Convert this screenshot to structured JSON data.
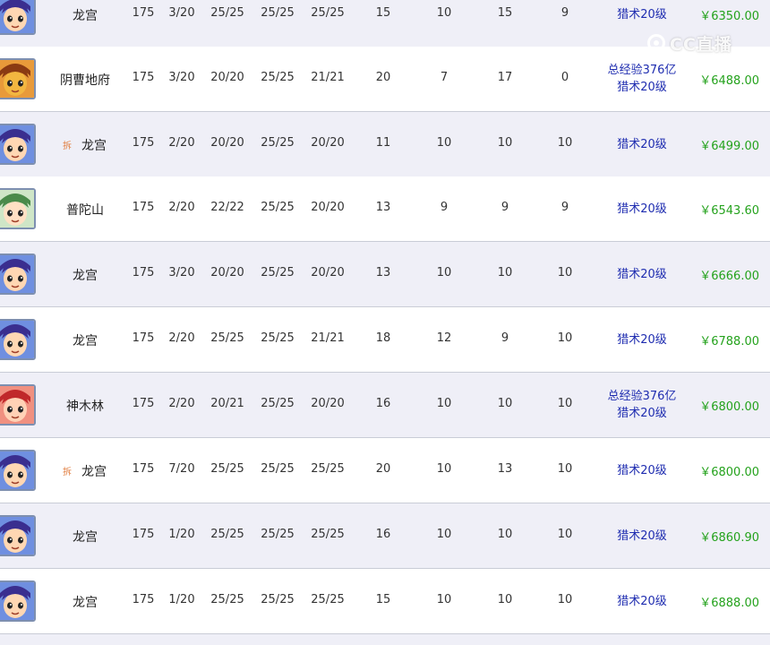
{
  "watermark": {
    "text": "CC直播",
    "icon": "cc-live-logo-icon"
  },
  "rows": [
    {
      "avatar": "dragon-palace-avatar-icon",
      "tag": "",
      "school": "龙宫",
      "level": "175",
      "c1": "3/20",
      "c2": "25/25",
      "c3": "25/25",
      "c4": "25/25",
      "n1": "15",
      "n2": "10",
      "n3": "15",
      "n4": "9",
      "skill": [
        "猎术20级"
      ],
      "price": "￥6350.00"
    },
    {
      "avatar": "underworld-avatar-icon",
      "tag": "",
      "school": "阴曹地府",
      "level": "175",
      "c1": "3/20",
      "c2": "20/20",
      "c3": "25/25",
      "c4": "21/21",
      "n1": "20",
      "n2": "7",
      "n3": "17",
      "n4": "0",
      "skill": [
        "总经验376亿",
        "猎术20级"
      ],
      "price": "￥6488.00"
    },
    {
      "avatar": "dragon-palace-avatar-icon",
      "tag": "拆",
      "school": "龙宫",
      "level": "175",
      "c1": "2/20",
      "c2": "20/20",
      "c3": "25/25",
      "c4": "20/20",
      "n1": "11",
      "n2": "10",
      "n3": "10",
      "n4": "10",
      "skill": [
        "猎术20级"
      ],
      "price": "￥6499.00"
    },
    {
      "avatar": "putuo-avatar-icon",
      "tag": "",
      "school": "普陀山",
      "level": "175",
      "c1": "2/20",
      "c2": "22/22",
      "c3": "25/25",
      "c4": "20/20",
      "n1": "13",
      "n2": "9",
      "n3": "9",
      "n4": "9",
      "skill": [
        "猎术20级"
      ],
      "price": "￥6543.60"
    },
    {
      "avatar": "dragon-palace-avatar-icon",
      "tag": "",
      "school": "龙宫",
      "level": "175",
      "c1": "3/20",
      "c2": "20/20",
      "c3": "25/25",
      "c4": "20/20",
      "n1": "13",
      "n2": "10",
      "n3": "10",
      "n4": "10",
      "skill": [
        "猎术20级"
      ],
      "price": "￥6666.00"
    },
    {
      "avatar": "dragon-palace-avatar-icon",
      "tag": "",
      "school": "龙宫",
      "level": "175",
      "c1": "2/20",
      "c2": "25/25",
      "c3": "25/25",
      "c4": "21/21",
      "n1": "18",
      "n2": "12",
      "n3": "9",
      "n4": "10",
      "skill": [
        "猎术20级"
      ],
      "price": "￥6788.00"
    },
    {
      "avatar": "shenmulin-avatar-icon",
      "tag": "",
      "school": "神木林",
      "level": "175",
      "c1": "2/20",
      "c2": "20/21",
      "c3": "25/25",
      "c4": "20/20",
      "n1": "16",
      "n2": "10",
      "n3": "10",
      "n4": "10",
      "skill": [
        "总经验376亿",
        "猎术20级"
      ],
      "price": "￥6800.00"
    },
    {
      "avatar": "dragon-palace-avatar-icon",
      "tag": "拆",
      "school": "龙宫",
      "level": "175",
      "c1": "7/20",
      "c2": "25/25",
      "c3": "25/25",
      "c4": "25/25",
      "n1": "20",
      "n2": "10",
      "n3": "13",
      "n4": "10",
      "skill": [
        "猎术20级"
      ],
      "price": "￥6800.00"
    },
    {
      "avatar": "dragon-palace-avatar-icon",
      "tag": "",
      "school": "龙宫",
      "level": "175",
      "c1": "1/20",
      "c2": "25/25",
      "c3": "25/25",
      "c4": "25/25",
      "n1": "16",
      "n2": "10",
      "n3": "10",
      "n4": "10",
      "skill": [
        "猎术20级"
      ],
      "price": "￥6860.90"
    },
    {
      "avatar": "dragon-palace-avatar-icon",
      "tag": "",
      "school": "龙宫",
      "level": "175",
      "c1": "1/20",
      "c2": "25/25",
      "c3": "25/25",
      "c4": "25/25",
      "n1": "15",
      "n2": "10",
      "n3": "10",
      "n4": "10",
      "skill": [
        "猎术20级"
      ],
      "price": "￥6888.00"
    }
  ]
}
